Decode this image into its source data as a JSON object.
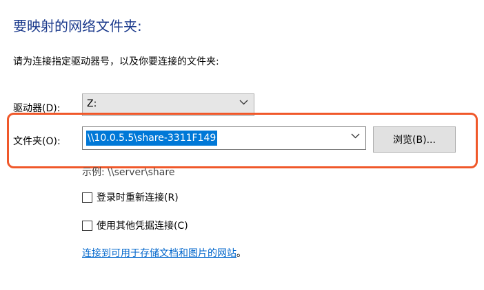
{
  "dialog": {
    "heading": "要映射的网络文件夹:",
    "instruction": "请为连接指定驱动器号，以及你要连接的文件夹:"
  },
  "drive": {
    "label": "驱动器(D):",
    "value": "Z:"
  },
  "folder": {
    "label": "文件夹(O):",
    "value": "\\\\10.0.5.5\\share-3311F149",
    "browse_label": "浏览(B)..."
  },
  "example_text": "示例: \\\\server\\share",
  "options": {
    "reconnect_label": "登录时重新连接(R)",
    "reconnect_checked": false,
    "other_credentials_label": "使用其他凭据连接(C)",
    "other_credentials_checked": false
  },
  "link": {
    "text": "连接到可用于存储文档和图片的网站",
    "suffix": "。"
  },
  "colors": {
    "heading": "#1b3a8c",
    "selection": "#0078d7",
    "highlight_border": "#f0582a",
    "link": "#0066cc"
  }
}
